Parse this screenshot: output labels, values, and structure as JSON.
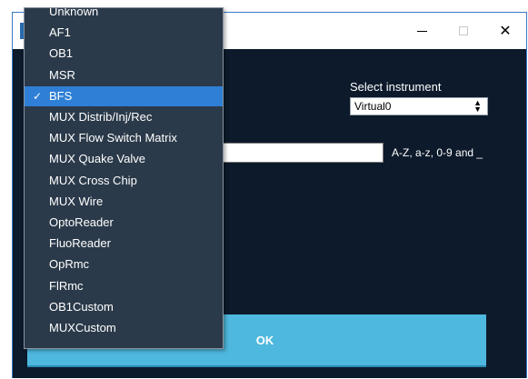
{
  "window": {
    "controls": {
      "minimize": "—",
      "close": "✕"
    }
  },
  "form": {
    "select_label": "Select instrument",
    "select_value": "Virtual0",
    "name_value": "",
    "name_hint": "A-Z, a-z, 0-9 and _",
    "ok_label": "OK"
  },
  "dropdown": {
    "selected": "BFS",
    "items": [
      "Unknown",
      "AF1",
      "OB1",
      "MSR",
      "BFS",
      "MUX Distrib/Inj/Rec",
      "MUX Flow Switch Matrix",
      "MUX Quake Valve",
      "MUX Cross Chip",
      "MUX Wire",
      "OptoReader",
      "FluoReader",
      "OpRmc",
      "FlRmc",
      "OB1Custom",
      "MUXCustom"
    ]
  },
  "colors": {
    "client_bg": "#0c1a2b",
    "dropdown_bg": "#2b3a4a",
    "selected_bg": "#2f7fd6",
    "ok_bg": "#4fb8de"
  }
}
